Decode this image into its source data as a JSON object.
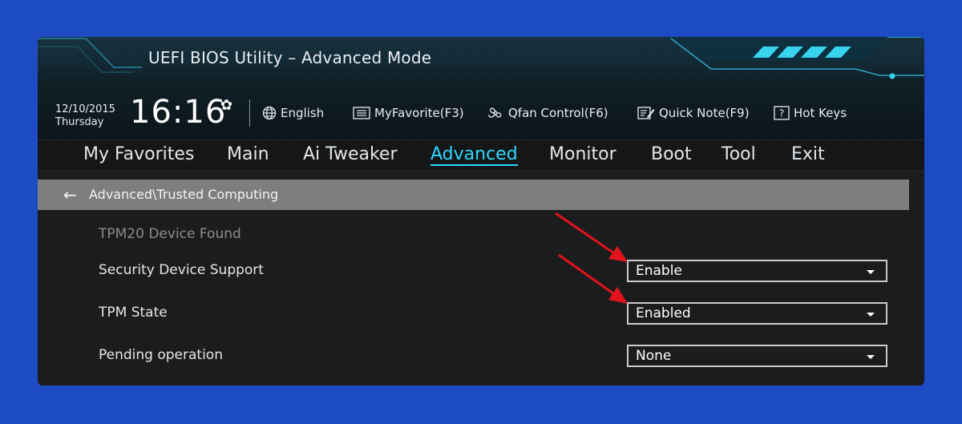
{
  "window": {
    "title": "UEFI BIOS Utility – Advanced Mode"
  },
  "status": {
    "date": "12/10/2015",
    "weekday": "Thursday",
    "time": "16:16",
    "tools": [
      {
        "icon": "globe-icon",
        "label": "English"
      },
      {
        "icon": "favorite-list-icon",
        "label": "MyFavorite(F3)"
      },
      {
        "icon": "fan-icon",
        "label": "Qfan Control(F6)"
      },
      {
        "icon": "note-icon",
        "label": "Quick Note(F9)"
      },
      {
        "icon": "question-box-icon",
        "label": "Hot Keys"
      }
    ]
  },
  "menu": {
    "items": [
      "My Favorites",
      "Main",
      "Ai Tweaker",
      "Advanced",
      "Monitor",
      "Boot",
      "Tool",
      "Exit"
    ],
    "active": "Advanced"
  },
  "breadcrumb": {
    "path": "Advanced\\Trusted Computing"
  },
  "settings": {
    "info": "TPM20 Device Found",
    "rows": [
      {
        "label": "Security Device Support",
        "value": "Enable"
      },
      {
        "label": "TPM State",
        "value": "Enabled"
      },
      {
        "label": "Pending operation",
        "value": "None"
      }
    ]
  },
  "colors": {
    "page_background": "#1d4bc4",
    "accent": "#2ed7ff",
    "annotation_arrow": "#e0141a"
  }
}
